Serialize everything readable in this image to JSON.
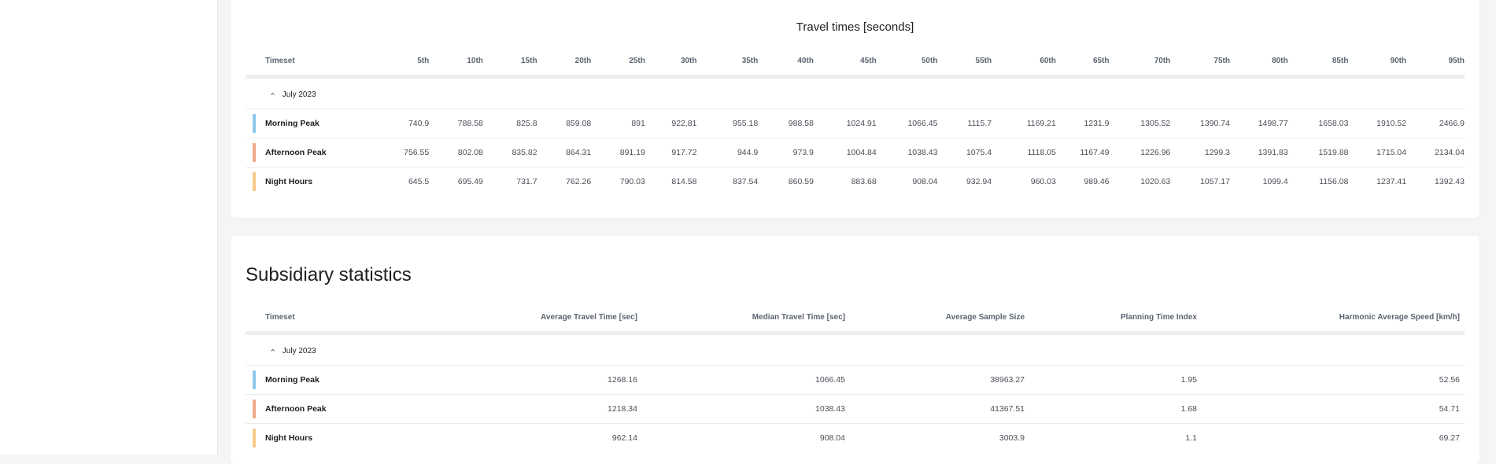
{
  "colors": {
    "morning_peak": "#8cc8ea",
    "afternoon_peak": "#f0a98a",
    "night_hours": "#f7c98a"
  },
  "travel_times": {
    "title": "Travel times [seconds]",
    "timeset_header": "Timeset",
    "percentile_headers": [
      "5th",
      "10th",
      "15th",
      "20th",
      "25th",
      "30th",
      "35th",
      "40th",
      "45th",
      "50th",
      "55th",
      "60th",
      "65th",
      "70th",
      "75th",
      "80th",
      "85th",
      "90th",
      "95th"
    ],
    "group_label": "July 2023",
    "rows": [
      {
        "label": "Morning Peak",
        "values": [
          "740.9",
          "788.58",
          "825.8",
          "859.08",
          "891",
          "922.81",
          "955.18",
          "988.58",
          "1024.91",
          "1066.45",
          "1115.7",
          "1169.21",
          "1231.9",
          "1305.52",
          "1390.74",
          "1498.77",
          "1658.03",
          "1910.52",
          "2466.9"
        ]
      },
      {
        "label": "Afternoon Peak",
        "values": [
          "756.55",
          "802.08",
          "835.82",
          "864.31",
          "891.19",
          "917.72",
          "944.9",
          "973.9",
          "1004.84",
          "1038.43",
          "1075.4",
          "1118.05",
          "1167.49",
          "1226.96",
          "1299.3",
          "1391.83",
          "1519.88",
          "1715.04",
          "2134.04"
        ]
      },
      {
        "label": "Night Hours",
        "values": [
          "645.5",
          "695.49",
          "731.7",
          "762.26",
          "790.03",
          "814.58",
          "837.54",
          "860.59",
          "883.68",
          "908.04",
          "932.94",
          "960.03",
          "989.46",
          "1020.63",
          "1057.17",
          "1099.4",
          "1156.08",
          "1237.41",
          "1392.43"
        ]
      }
    ]
  },
  "subsidiary": {
    "title": "Subsidiary statistics",
    "headers": {
      "timeset": "Timeset",
      "avg_travel_time": "Average Travel Time [sec]",
      "median_travel_time": "Median Travel Time [sec]",
      "avg_sample_size": "Average Sample Size",
      "planning_time_index": "Planning Time Index",
      "harmonic_avg_speed": "Harmonic Average Speed [km/h]"
    },
    "group_label": "July 2023",
    "rows": [
      {
        "label": "Morning Peak",
        "avg_travel_time": "1268.16",
        "median_travel_time": "1066.45",
        "avg_sample_size": "38963.27",
        "planning_time_index": "1.95",
        "harmonic_avg_speed": "52.56"
      },
      {
        "label": "Afternoon Peak",
        "avg_travel_time": "1218.34",
        "median_travel_time": "1038.43",
        "avg_sample_size": "41367.51",
        "planning_time_index": "1.68",
        "harmonic_avg_speed": "54.71"
      },
      {
        "label": "Night Hours",
        "avg_travel_time": "962.14",
        "median_travel_time": "908.04",
        "avg_sample_size": "3003.9",
        "planning_time_index": "1.1",
        "harmonic_avg_speed": "69.27"
      }
    ]
  }
}
